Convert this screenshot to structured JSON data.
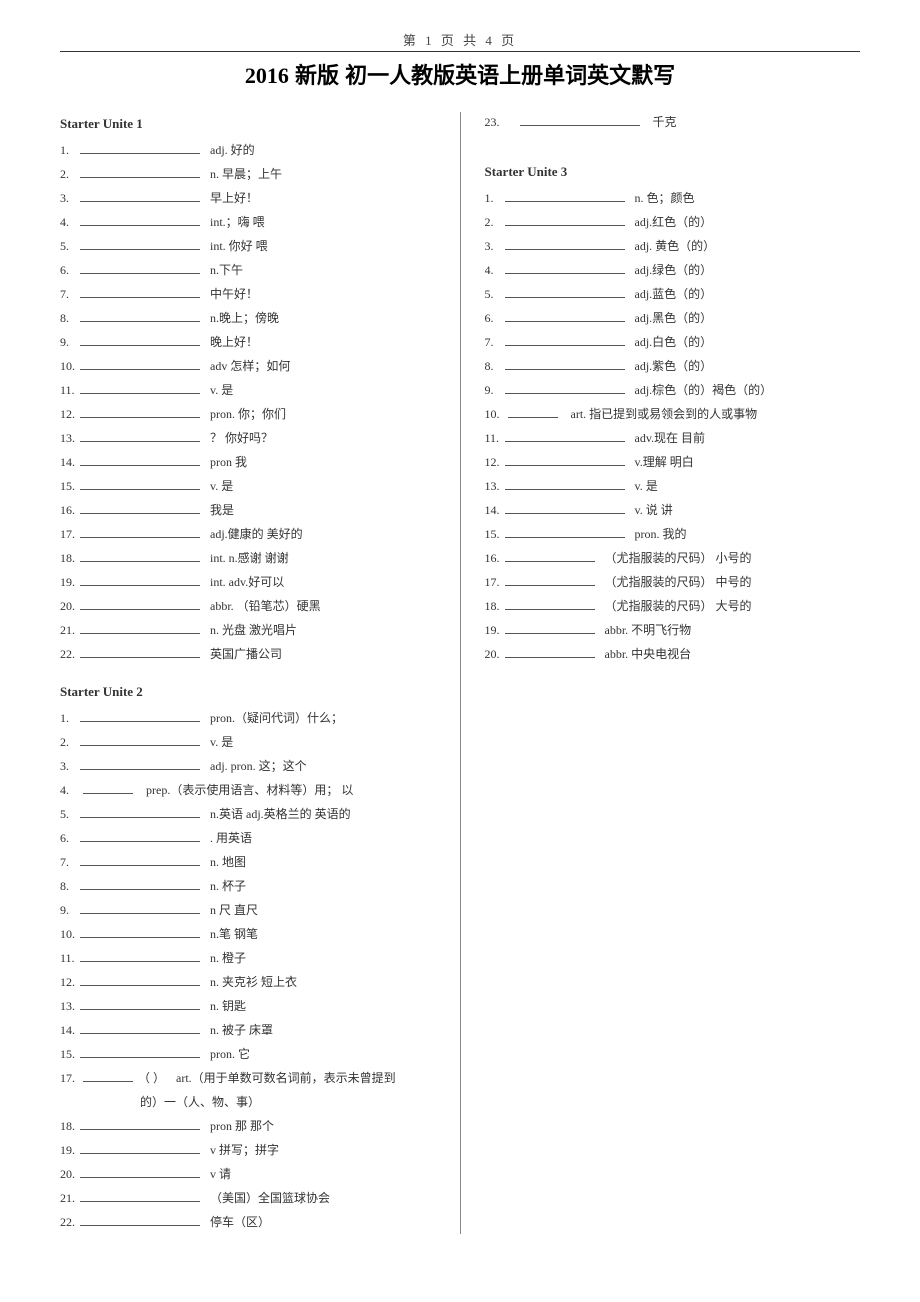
{
  "page_header": "第 1 页 共 4 页",
  "title_year": "2016",
  "title_rest": " 新版 初一人教版英语上册单词英文默写",
  "unit1": {
    "heading": "Starter Unite   1",
    "items": [
      {
        "n": "1.",
        "d": "adj.   好的"
      },
      {
        "n": "2.",
        "d": "n.      早晨；上午"
      },
      {
        "n": "3.",
        "d": "早上好！"
      },
      {
        "n": "4.",
        "d": "int.；嗨   喂"
      },
      {
        "n": "5.",
        "d": "int.   你好   喂"
      },
      {
        "n": "6.",
        "d": "n.下午"
      },
      {
        "n": "7.",
        "d": "中午好！"
      },
      {
        "n": "8.",
        "d": "n.晚上；傍晚"
      },
      {
        "n": "9.",
        "d": "晚上好！"
      },
      {
        "n": "10.",
        "d": "adv 怎样；如何"
      },
      {
        "n": "11.",
        "d": "v.   是"
      },
      {
        "n": "12.",
        "d": "pron. 你；你们"
      },
      {
        "n": "13.",
        "d": "？    你好吗？"
      },
      {
        "n": "14.",
        "d": "pron   我"
      },
      {
        "n": "15.",
        "d": "v.   是"
      },
      {
        "n": "16.",
        "d": "我是"
      },
      {
        "n": "17.",
        "d": "adj.健康的 美好的"
      },
      {
        "n": "18.",
        "d": "int. n.感谢  谢谢"
      },
      {
        "n": "19.",
        "d": "int. adv.好可以"
      },
      {
        "n": "20.",
        "d": "abbr. （铅笔芯）硬黑"
      },
      {
        "n": "21.",
        "d": "n. 光盘   激光唱片"
      },
      {
        "n": "22.",
        "d": "英国广播公司"
      }
    ]
  },
  "unit2": {
    "heading": "Starter   Unite   2",
    "items_a": [
      {
        "n": "1.",
        "d": "pron.（疑问代词）什么；"
      },
      {
        "n": "2.",
        "d": "v.   是"
      },
      {
        "n": "3.",
        "d": "adj. pron.   这；这个"
      }
    ],
    "item4": {
      "n": "4.",
      "d": "prep.（表示使用语言、材料等）用； 以"
    },
    "items_b": [
      {
        "n": "5.",
        "d": "n.英语  adj.英格兰的  英语的"
      },
      {
        "n": "6.",
        "d": ". 用英语"
      },
      {
        "n": "7.",
        "d": "n. 地图"
      },
      {
        "n": "8.",
        "d": "n.    杯子"
      },
      {
        "n": "9.",
        "d": "n     尺   直尺"
      },
      {
        "n": "10.",
        "d": "n.笔   钢笔"
      },
      {
        "n": "11.",
        "d": "n.   橙子"
      },
      {
        "n": "12.",
        "d": "n. 夹克衫   短上衣"
      },
      {
        "n": "13.",
        "d": "n.   钥匙"
      },
      {
        "n": "14.",
        "d": "n.   被子 床罩"
      },
      {
        "n": "15.",
        "d": "pron. 它"
      }
    ],
    "item17": {
      "n": "17.",
      "mid": "（      ）",
      "d": "art.（用于单数可数名词前，表示未曾提到"
    },
    "item17_line2": "的）一（人、物、事）",
    "items_c": [
      {
        "n": "18.",
        "d": "pron 那   那个"
      },
      {
        "n": "19.",
        "d": "v 拼写；拼字"
      },
      {
        "n": "20.",
        "d": "v  请"
      },
      {
        "n": "21.",
        "d": "（美国）全国篮球协会"
      },
      {
        "n": "22.",
        "d": "停车（区）"
      }
    ]
  },
  "item23": {
    "n": "23.",
    "d": "千克"
  },
  "unit3": {
    "heading": "Starter   Unite   3",
    "items": [
      {
        "n": "1.",
        "d": "n. 色；颜色"
      },
      {
        "n": "2.",
        "d": "adj.红色（的）"
      },
      {
        "n": "3.",
        "d": "adj. 黄色（的）"
      },
      {
        "n": "4.",
        "d": "adj.绿色（的）"
      },
      {
        "n": "5.",
        "d": "adj.蓝色（的）"
      },
      {
        "n": "6.",
        "d": "adj.黑色（的）"
      },
      {
        "n": "7.",
        "d": "adj.白色（的）"
      },
      {
        "n": "8.",
        "d": "adj.紫色（的）"
      },
      {
        "n": "9.",
        "d": "adj.棕色（的）褐色（的）"
      }
    ],
    "item10": {
      "n": "10.",
      "d": "art. 指已提到或易领会到的人或事物"
    },
    "items_b": [
      {
        "n": "11.",
        "d": "adv.现在   目前"
      },
      {
        "n": "12.",
        "d": "v.理解   明白"
      },
      {
        "n": "13.",
        "d": "v.   是"
      },
      {
        "n": "14.",
        "d": "v.   说  讲"
      },
      {
        "n": "15.",
        "d": "pron. 我的"
      }
    ],
    "items_c": [
      {
        "n": "16.",
        "d": "（尤指服装的尺码）  小号的"
      },
      {
        "n": "17.",
        "d": "（尤指服装的尺码）  中号的"
      },
      {
        "n": "18.",
        "d": "（尤指服装的尺码）  大号的"
      },
      {
        "n": "19.",
        "d": "abbr. 不明飞行物"
      },
      {
        "n": "20.",
        "d": "abbr. 中央电视台"
      }
    ]
  }
}
